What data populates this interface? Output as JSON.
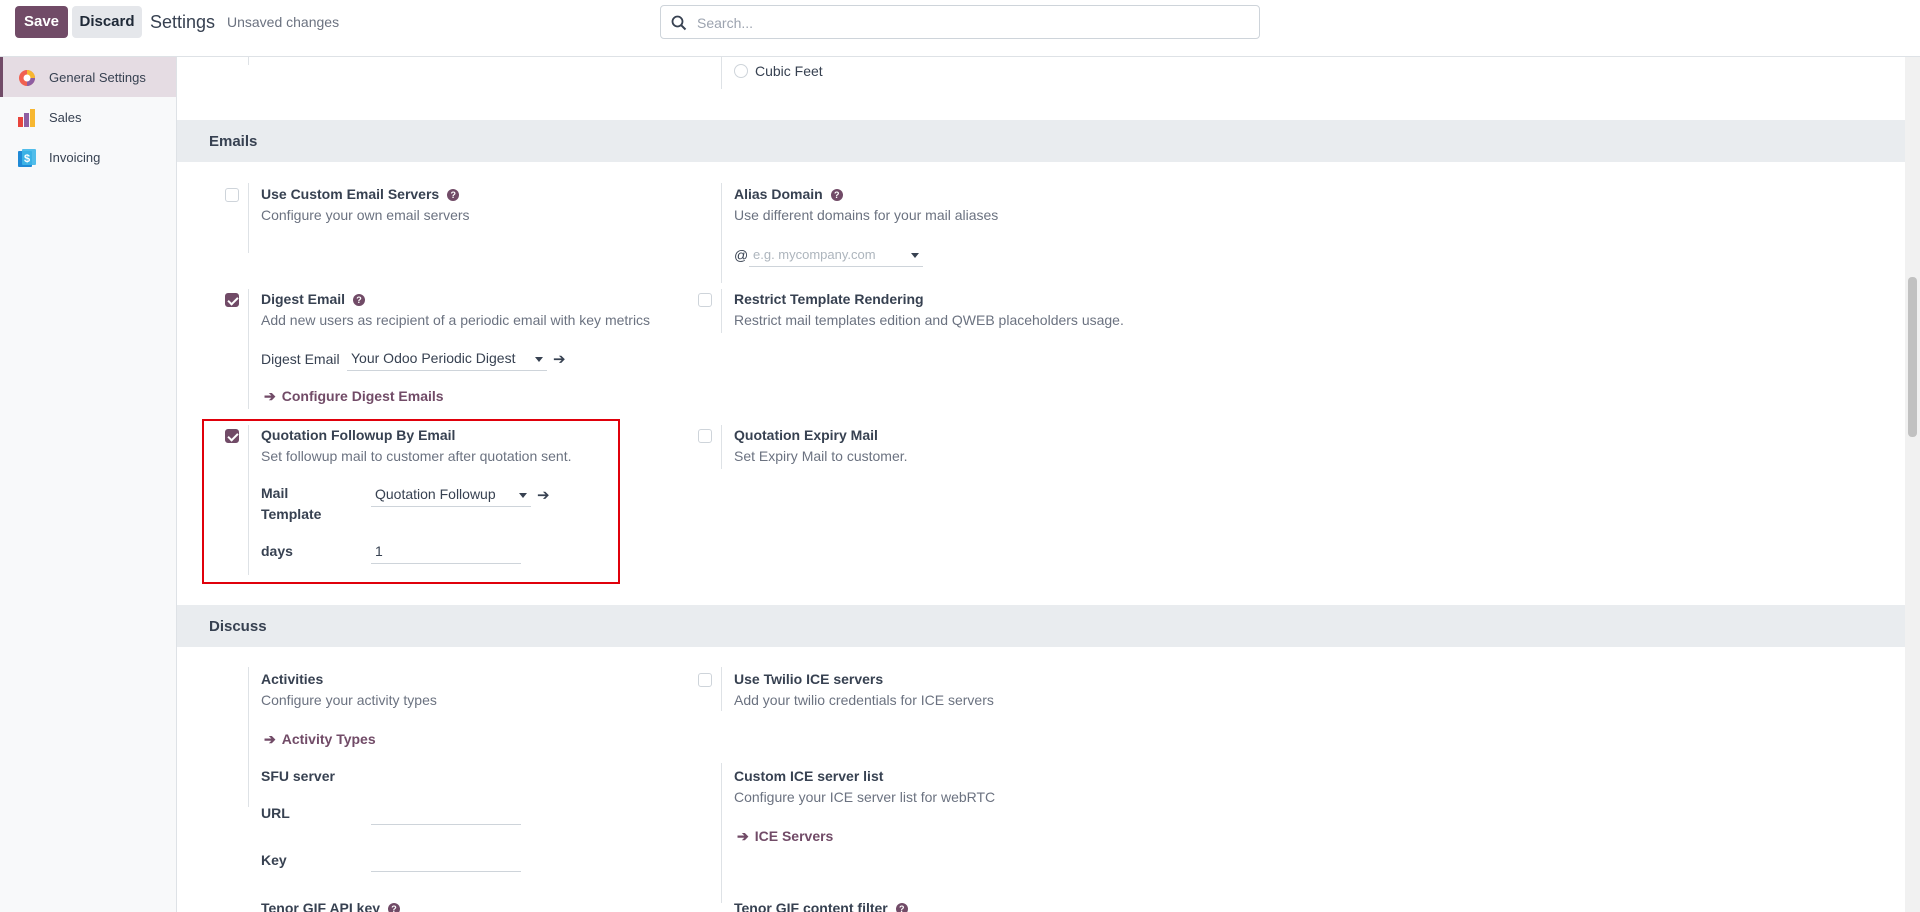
{
  "toolbar": {
    "save_label": "Save",
    "discard_label": "Discard",
    "title": "Settings",
    "status": "Unsaved changes"
  },
  "search": {
    "placeholder": "Search..."
  },
  "sidebar": {
    "items": [
      {
        "label": "General Settings",
        "icon": "general-settings-icon",
        "active": true
      },
      {
        "label": "Sales",
        "icon": "sales-icon",
        "active": false
      },
      {
        "label": "Invoicing",
        "icon": "invoicing-icon",
        "active": false
      }
    ]
  },
  "top_fragment": {
    "radio_label": "Cubic Feet"
  },
  "emails": {
    "title": "Emails",
    "custom_servers": {
      "title": "Use Custom Email Servers",
      "desc": "Configure your own email servers",
      "checked": false
    },
    "alias_domain": {
      "title": "Alias Domain",
      "desc": "Use different domains for your mail aliases",
      "at": "@",
      "placeholder": "e.g. mycompany.com"
    },
    "digest": {
      "title": "Digest Email",
      "desc": "Add new users as recipient of a periodic email with key metrics",
      "checked": true,
      "field_label": "Digest Email",
      "field_value": "Your Odoo Periodic Digest",
      "link": "Configure Digest Emails"
    },
    "restrict": {
      "title": "Restrict Template Rendering",
      "desc": "Restrict mail templates edition and QWEB placeholders usage.",
      "checked": false
    },
    "followup": {
      "title": "Quotation Followup By Email",
      "desc": "Set followup mail to customer after quotation sent.",
      "checked": true,
      "template_label_1": "Mail",
      "template_label_2": "Template",
      "template_value": "Quotation Followup",
      "days_label": "days",
      "days_value": "1"
    },
    "expiry": {
      "title": "Quotation Expiry Mail",
      "desc": "Set Expiry Mail to customer.",
      "checked": false
    }
  },
  "discuss": {
    "title": "Discuss",
    "activities": {
      "title": "Activities",
      "desc": "Configure your activity types",
      "link": "Activity Types"
    },
    "twilio": {
      "title": "Use Twilio ICE servers",
      "desc": "Add your twilio credentials for ICE servers",
      "checked": false
    },
    "sfu": {
      "title": "SFU server",
      "url_label": "URL",
      "key_label": "Key",
      "url_value": "",
      "key_value": ""
    },
    "ice_list": {
      "title": "Custom ICE server list",
      "desc": "Configure your ICE server list for webRTC",
      "link": "ICE Servers"
    },
    "tenor_key": {
      "title": "Tenor GIF API key"
    },
    "tenor_filter": {
      "title": "Tenor GIF content filter"
    }
  },
  "arrow_glyph": "➔",
  "colors": {
    "brand": "#714b67",
    "highlight": "#e0000b"
  }
}
